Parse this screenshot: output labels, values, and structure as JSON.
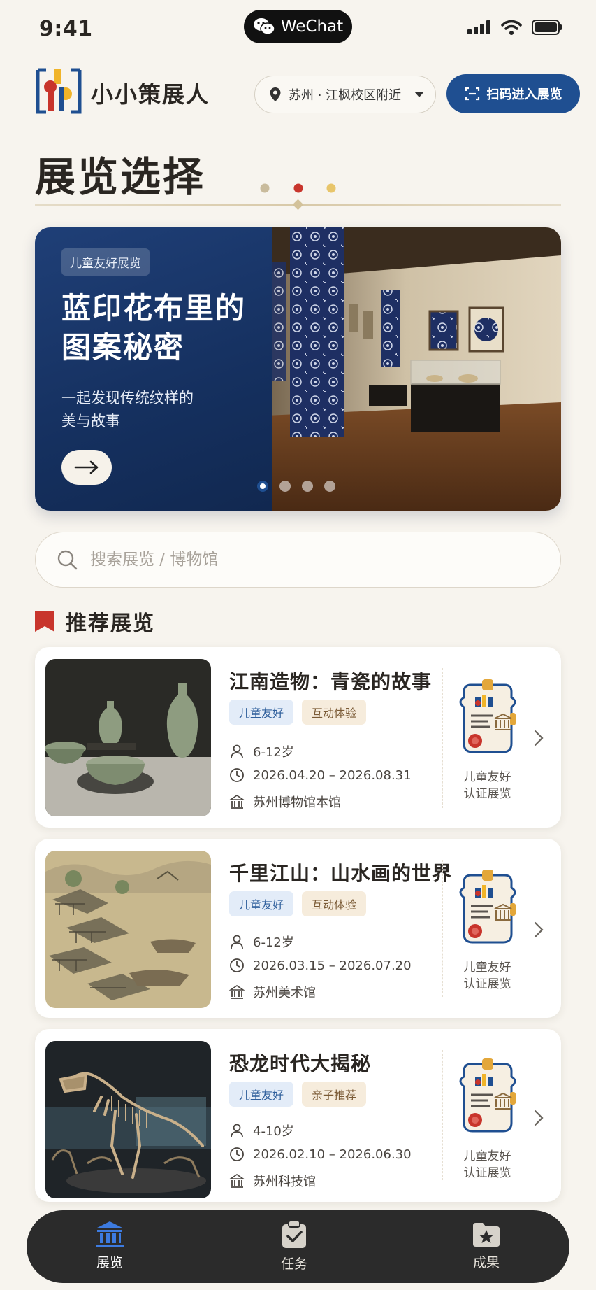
{
  "status_bar": {
    "time": "9:41",
    "app_pill": "WeChat"
  },
  "header": {
    "app_name": "小小策展人",
    "location": "苏州 · 江枫校区附近",
    "scan_button": "扫码进入展览"
  },
  "page": {
    "title": "展览选择"
  },
  "banner": {
    "tag": "儿童友好展览",
    "title_line1": "蓝印花布里的",
    "title_line2": "图案秘密",
    "subtitle_line1": "一起发现传统纹样的",
    "subtitle_line2": "美与故事",
    "slide_count": 4,
    "active_slide": 1
  },
  "search": {
    "placeholder": "搜索展览 / 博物馆"
  },
  "recommended": {
    "title": "推荐展览",
    "items": [
      {
        "title": "江南造物：青瓷的故事",
        "tags": [
          "儿童友好",
          "互动体验"
        ],
        "age": "6-12岁",
        "dates": "2026.04.20 – 2026.08.31",
        "venue": "苏州博物馆本馆",
        "badge_line1": "儿童友好",
        "badge_line2": "认证展览"
      },
      {
        "title": "千里江山：山水画的世界",
        "tags": [
          "儿童友好",
          "互动体验"
        ],
        "age": "6-12岁",
        "dates": "2026.03.15 – 2026.07.20",
        "venue": "苏州美术馆",
        "badge_line1": "儿童友好",
        "badge_line2": "认证展览"
      },
      {
        "title": "恐龙时代大揭秘",
        "tags": [
          "儿童友好",
          "亲子推荐"
        ],
        "age": "4-10岁",
        "dates": "2026.02.10 – 2026.06.30",
        "venue": "苏州科技馆",
        "badge_line1": "儿童友好",
        "badge_line2": "认证展览"
      }
    ]
  },
  "tabbar": {
    "tabs": [
      {
        "label": "展览",
        "icon": "museum-icon",
        "active": true
      },
      {
        "label": "任务",
        "icon": "clipboard-check-icon",
        "active": false
      },
      {
        "label": "成果",
        "icon": "star-folder-icon",
        "active": false
      }
    ]
  },
  "colors": {
    "primary": "#1f4f91",
    "background": "#f7f4ee",
    "accent_red": "#c8352c",
    "tabbar": "#2b2b2b"
  }
}
